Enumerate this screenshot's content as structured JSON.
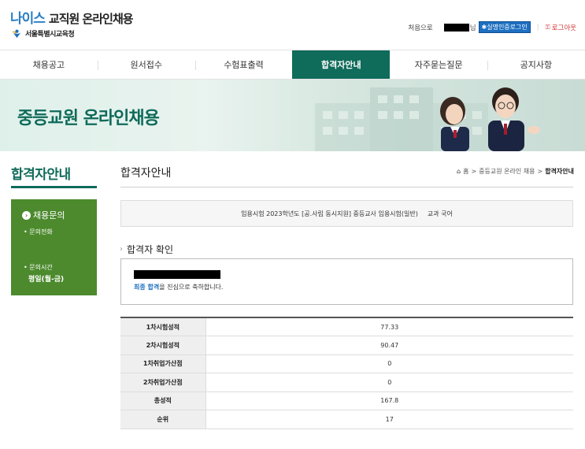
{
  "header": {
    "brand": "나이스",
    "title": "교직원 온라인채용",
    "org": "서울특별시교육청",
    "home_link": "처음으로",
    "user_suffix": "님",
    "cert_badge": "실명인증로그인",
    "logout": "로그아웃"
  },
  "nav": [
    {
      "label": "채용공고",
      "active": false
    },
    {
      "label": "원서접수",
      "active": false
    },
    {
      "label": "수험표출력",
      "active": false
    },
    {
      "label": "합격자안내",
      "active": true
    },
    {
      "label": "자주묻는질문",
      "active": false
    },
    {
      "label": "공지사항",
      "active": false
    }
  ],
  "banner": {
    "title": "중등교원 온라인채용"
  },
  "sidebar": {
    "title": "합격자안내",
    "inquiry_label": "채용문의",
    "phone_label": "문의전화",
    "hours_label": "문의시간",
    "hours_value": "평일(월-금)"
  },
  "main": {
    "page_title": "합격자안내",
    "breadcrumb": {
      "home": "홈",
      "level1": "중등교원 온라인 채용",
      "current": "합격자안내"
    },
    "exam_info": "임용시험 2023학년도 [공.사립 동시지원] 중등교사 임용시험(일반)",
    "subject": "교과 국어",
    "section_title": "합격자 확인",
    "congrats_pass": "최종 합격",
    "congrats_rest": "을 진심으로 축하합니다.",
    "scores": [
      {
        "label": "1차시험성적",
        "value": "77.33"
      },
      {
        "label": "2차시험성적",
        "value": "90.47"
      },
      {
        "label": "1차취업가산점",
        "value": "0"
      },
      {
        "label": "2차취업가산점",
        "value": "0"
      },
      {
        "label": "총성적",
        "value": "167.8"
      },
      {
        "label": "순위",
        "value": "17"
      }
    ]
  },
  "colors": {
    "primary": "#0f6b5a",
    "sidebar_green": "#4c8a2d",
    "brand_blue": "#2a7fc6",
    "logout_red": "#d23a3a"
  }
}
